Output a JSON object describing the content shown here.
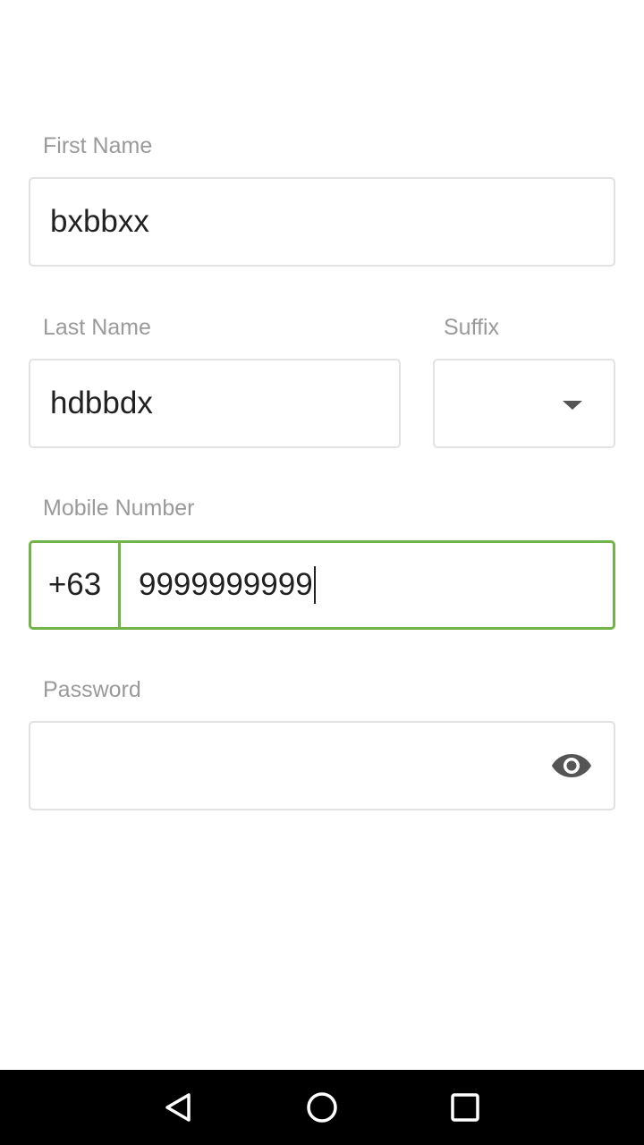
{
  "form": {
    "first_name": {
      "label": "First Name",
      "value": "bxbbxx"
    },
    "last_name": {
      "label": "Last Name",
      "value": "hdbbdx"
    },
    "suffix": {
      "label": "Suffix",
      "value": ""
    },
    "mobile": {
      "label": "Mobile Number",
      "country_code": "+63",
      "value": "9999999999"
    },
    "password": {
      "label": "Password",
      "value": "",
      "toggle_icon": "eye-icon"
    }
  },
  "colors": {
    "accent": "#72b34a",
    "border": "#e2e2e2",
    "label": "#9a9a9a",
    "text": "#212121",
    "navbar": "#000000"
  },
  "navbar": {
    "icons": [
      "back-icon",
      "home-icon",
      "recents-icon"
    ]
  }
}
